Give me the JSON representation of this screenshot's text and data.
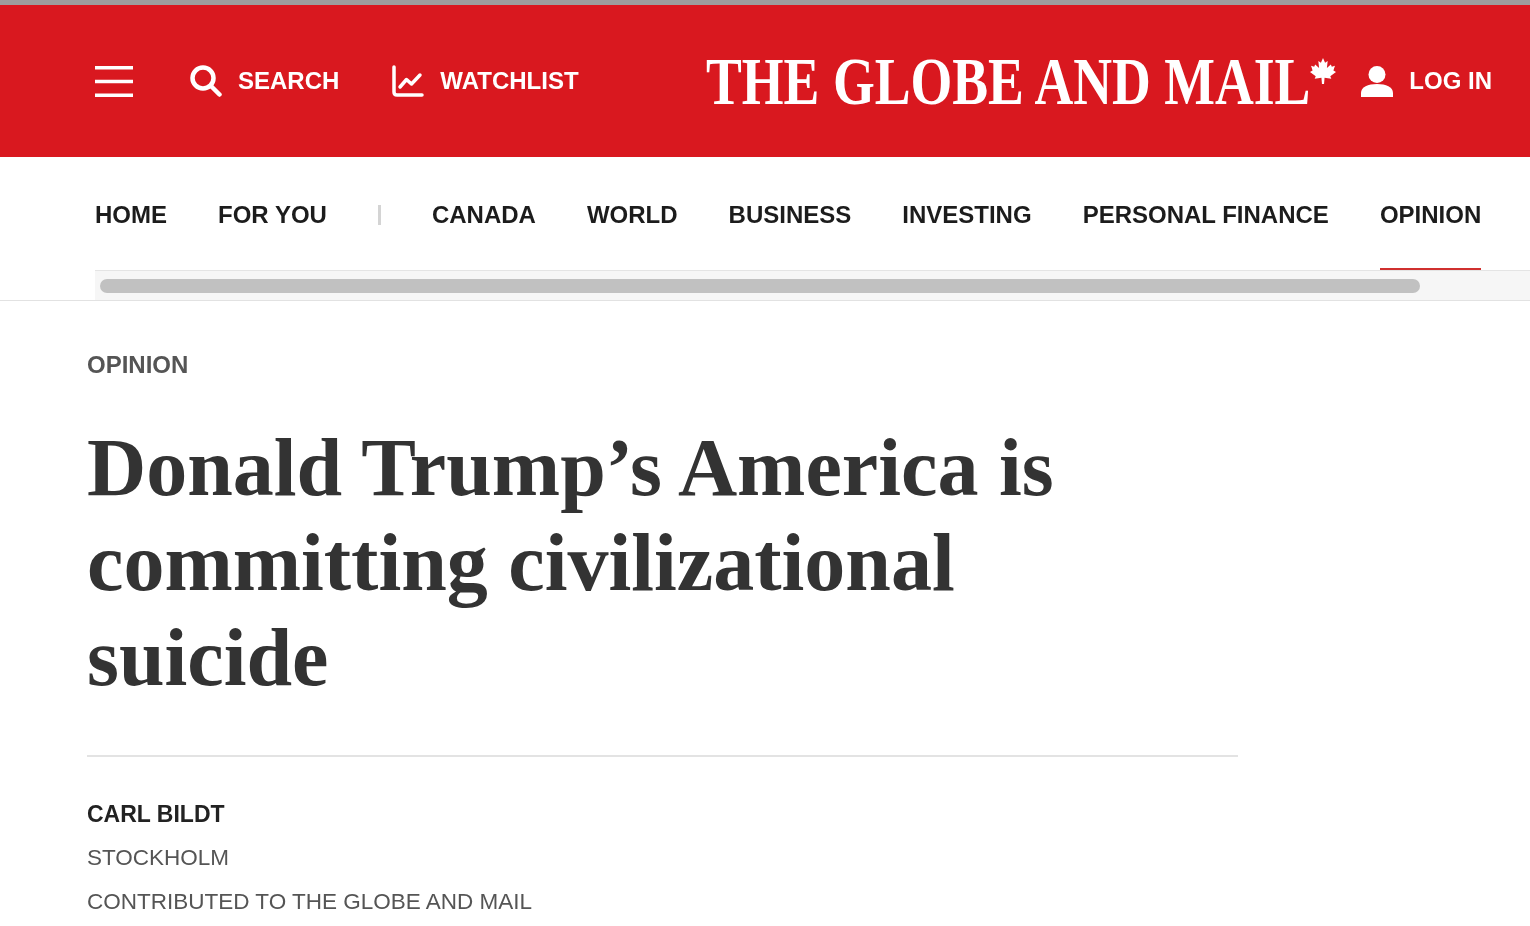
{
  "header": {
    "actions": [
      {
        "kind": "search",
        "label": "SEARCH"
      },
      {
        "kind": "watchlist",
        "label": "WATCHLIST"
      }
    ],
    "logo": "THE GLOBE AND MAIL",
    "login": {
      "label": "LOG IN"
    }
  },
  "nav": {
    "personal": [
      {
        "label": "HOME",
        "selected": false
      },
      {
        "label": "FOR YOU",
        "selected": false
      }
    ],
    "sections": [
      {
        "label": "CANADA",
        "selected": false
      },
      {
        "label": "WORLD",
        "selected": false
      },
      {
        "label": "BUSINESS",
        "selected": false
      },
      {
        "label": "INVESTING",
        "selected": false
      },
      {
        "label": "PERSONAL FINANCE",
        "selected": false
      },
      {
        "label": "OPINION",
        "selected": true
      }
    ]
  },
  "article": {
    "section": "OPINION",
    "headline": "Donald Trump’s America is committing civilizational suicide",
    "byline": {
      "author": "CARL BILDT",
      "location": "STOCKHOLM",
      "credit": "CONTRIBUTED TO THE GLOBE AND MAIL"
    }
  }
}
